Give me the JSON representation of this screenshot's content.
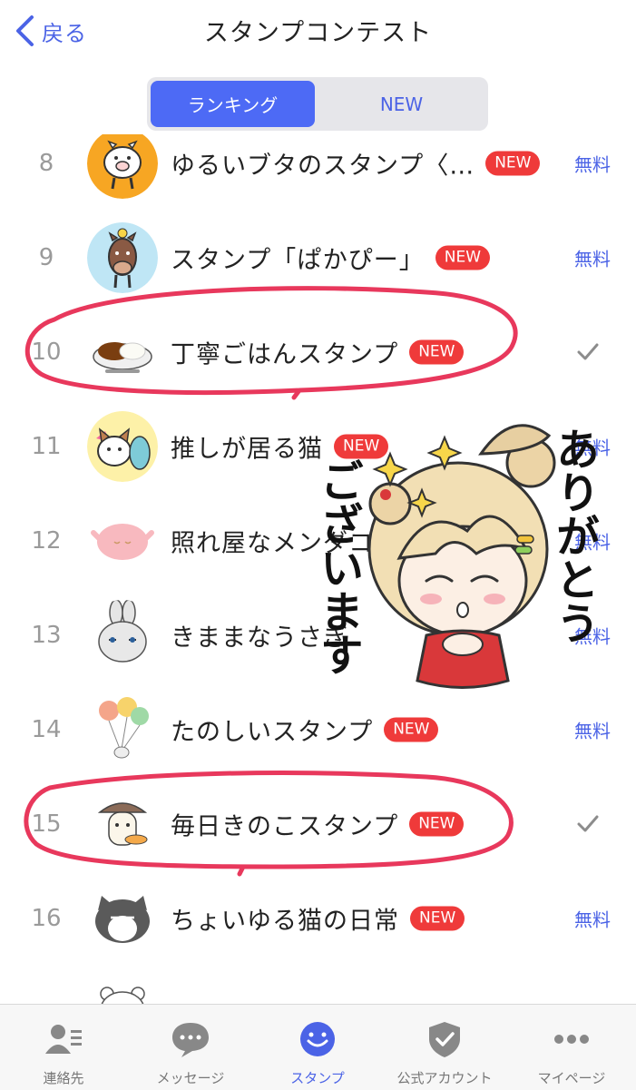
{
  "header": {
    "back_label": "戻る",
    "title": "スタンプコンテスト"
  },
  "segmented": {
    "ranking_label": "ランキング",
    "new_label": "NEW",
    "selected": "ランキング"
  },
  "list": {
    "items": [
      {
        "rank": "8",
        "name": "ゆるいブタのスタンプ〈…",
        "badge": "NEW",
        "price": "無料",
        "thumb_icon": "pig-icon"
      },
      {
        "rank": "9",
        "name": "スタンプ「ぱかぴー」",
        "badge": "NEW",
        "price": "無料",
        "thumb_icon": "horse-icon"
      },
      {
        "rank": "10",
        "name": "丁寧ごはんスタンプ",
        "badge": "NEW",
        "status_icon": "check-icon",
        "thumb_icon": "curry-icon"
      },
      {
        "rank": "11",
        "name": "推しが居る猫",
        "badge": "NEW",
        "price": "無料",
        "thumb_icon": "cat-icon"
      },
      {
        "rank": "12",
        "name": "照れ屋なメンダコ",
        "badge": "",
        "price": "無料",
        "thumb_icon": "octopus-icon"
      },
      {
        "rank": "13",
        "name": "きままなうさぎ",
        "badge": "",
        "price": "無料",
        "thumb_icon": "rabbit-icon"
      },
      {
        "rank": "14",
        "name": "たのしいスタンプ",
        "badge": "NEW",
        "price": "無料",
        "thumb_icon": "balloons-icon"
      },
      {
        "rank": "15",
        "name": "毎日きのこスタンプ",
        "badge": "NEW",
        "status_icon": "check-icon",
        "thumb_icon": "mushroom-icon"
      },
      {
        "rank": "16",
        "name": "ちょいゆる猫の日常",
        "badge": "NEW",
        "price": "無料",
        "thumb_icon": "cat-icon"
      }
    ]
  },
  "overlay": {
    "illustration_text_right": "ありがとう",
    "illustration_text_left": "ございます"
  },
  "tabbar": {
    "tabs": [
      {
        "label": "連絡先",
        "icon": "contacts-icon"
      },
      {
        "label": "メッセージ",
        "icon": "message-icon"
      },
      {
        "label": "スタンプ",
        "icon": "sticker-smile-icon",
        "active": true
      },
      {
        "label": "公式アカウント",
        "icon": "shield-check-icon"
      },
      {
        "label": "マイページ",
        "icon": "more-dots-icon"
      }
    ]
  },
  "colors": {
    "accent": "#4b63e6",
    "segment_active": "#4d6af5",
    "badge": "#ef3a3a",
    "annotation_red": "#e8385c"
  }
}
